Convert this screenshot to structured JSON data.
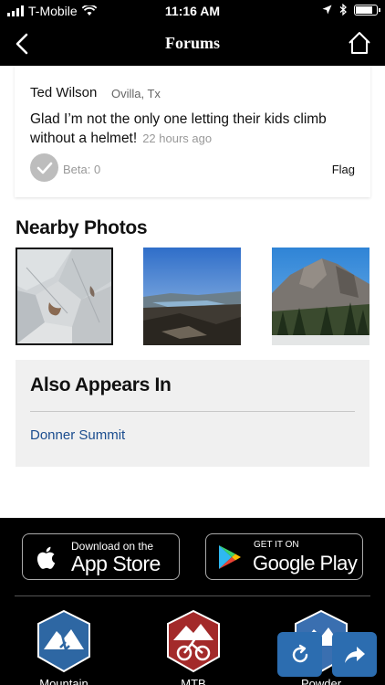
{
  "status_bar": {
    "carrier": "T-Mobile",
    "time": "11:16 AM",
    "battery_level": 0.85
  },
  "nav": {
    "title": "Forums"
  },
  "comment": {
    "author": "Ted Wilson",
    "location": "Ovilla, Tx",
    "text": "Glad I’m not the only one letting their kids climb without a helmet!",
    "time_ago": "22 hours ago",
    "beta_label": "Beta: 0",
    "flag_label": "Flag"
  },
  "nearby_photos": {
    "heading": "Nearby Photos"
  },
  "also_appears_in": {
    "heading": "Also Appears In",
    "link": "Donner Summit"
  },
  "footer": {
    "app_store": {
      "small": "Download on the",
      "big": "App Store"
    },
    "google_play": {
      "small": "GET IT ON",
      "big": "Google Play"
    },
    "sites": [
      {
        "label": "Mountain",
        "color": "#2e67a3"
      },
      {
        "label": "MTB",
        "color": "#a32a2a"
      },
      {
        "label": "Powder",
        "color": "#3a6fb0"
      }
    ]
  },
  "colors": {
    "accent": "#2c6db0",
    "link": "#1b4d8f",
    "header": "#000000"
  }
}
